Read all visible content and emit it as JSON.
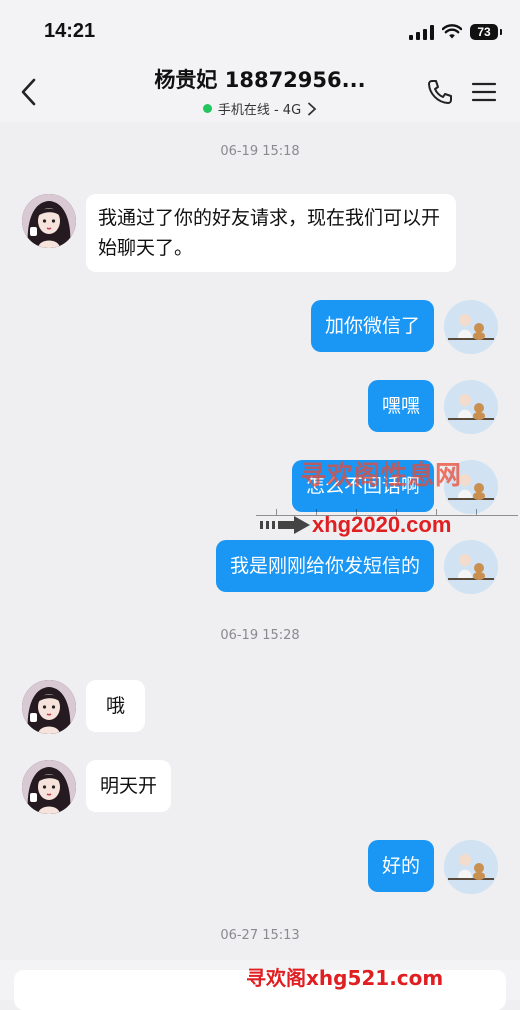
{
  "status_bar": {
    "time": "14:21",
    "battery": "73"
  },
  "header": {
    "contact_name": "杨贵妃 18872956...",
    "status_text": "手机在线 - 4G"
  },
  "messages": {
    "ts1": "06-19 15:18",
    "m1": "我通过了你的好友请求，现在我们可以开始聊天了。",
    "m2": "加你微信了",
    "m3": "嘿嘿",
    "m4": "怎么不回话啊",
    "m5": "我是刚刚给你发短信的",
    "ts2": "06-19 15:28",
    "m6": "哦",
    "m7": "明天开",
    "m8": "好的",
    "ts3": "06-27 15:13"
  },
  "watermarks": {
    "w1": "寻欢阁性息网",
    "w2": "xhg2020.com",
    "w3": "寻欢阁xhg521.com"
  },
  "colors": {
    "sent_bubble": "#1a96f5",
    "received_bubble": "#ffffff",
    "online": "#22c55e",
    "background": "#efeff1"
  }
}
